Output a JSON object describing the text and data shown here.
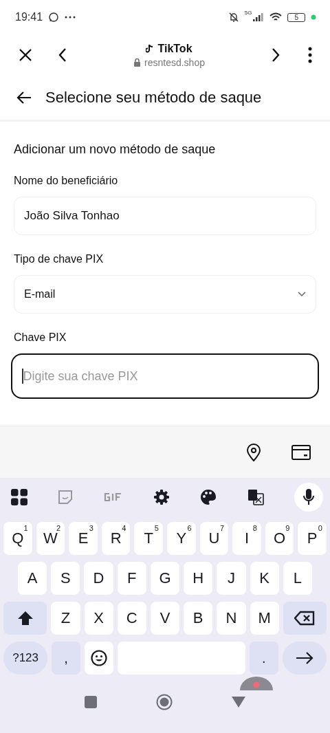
{
  "status_bar": {
    "time": "19:41",
    "network": "5G",
    "battery": "5"
  },
  "browser": {
    "title": "TikTok",
    "url": "resntesd.shop"
  },
  "page": {
    "title": "Selecione seu método de saque",
    "section": "Adicionar um novo método de saque"
  },
  "fields": [
    {
      "kind": "text",
      "label": "Nome do beneficiário",
      "value": "João Silva Tonhao",
      "focused": false
    },
    {
      "kind": "select",
      "label": "Tipo de chave PIX",
      "value": "E-mail",
      "focused": false
    },
    {
      "kind": "input",
      "label": "Chave PIX",
      "placeholder": "Digite sua chave PIX",
      "focused": true
    }
  ],
  "keyboard": {
    "rows": [
      [
        {
          "kind": "letter",
          "label": "Q",
          "hint": "1"
        },
        {
          "kind": "letter",
          "label": "W",
          "hint": "2"
        },
        {
          "kind": "letter",
          "label": "E",
          "hint": "3"
        },
        {
          "kind": "letter",
          "label": "R",
          "hint": "4"
        },
        {
          "kind": "letter",
          "label": "T",
          "hint": "5"
        },
        {
          "kind": "letter",
          "label": "Y",
          "hint": "6"
        },
        {
          "kind": "letter",
          "label": "U",
          "hint": "7"
        },
        {
          "kind": "letter",
          "label": "I",
          "hint": "8"
        },
        {
          "kind": "letter",
          "label": "O",
          "hint": "9"
        },
        {
          "kind": "letter",
          "label": "P",
          "hint": "0"
        }
      ],
      [
        {
          "kind": "letter",
          "label": "A"
        },
        {
          "kind": "letter",
          "label": "S"
        },
        {
          "kind": "letter",
          "label": "D"
        },
        {
          "kind": "letter",
          "label": "F"
        },
        {
          "kind": "letter",
          "label": "G"
        },
        {
          "kind": "letter",
          "label": "H"
        },
        {
          "kind": "letter",
          "label": "J"
        },
        {
          "kind": "letter",
          "label": "K"
        },
        {
          "kind": "letter",
          "label": "L"
        }
      ],
      [
        {
          "kind": "shift"
        },
        {
          "kind": "letter",
          "label": "Z"
        },
        {
          "kind": "letter",
          "label": "X"
        },
        {
          "kind": "letter",
          "label": "C"
        },
        {
          "kind": "letter",
          "label": "V"
        },
        {
          "kind": "letter",
          "label": "B"
        },
        {
          "kind": "letter",
          "label": "N"
        },
        {
          "kind": "letter",
          "label": "M"
        },
        {
          "kind": "backspace"
        }
      ]
    ],
    "bottom_row": [
      {
        "kind": "symbols",
        "label": "?123"
      },
      {
        "kind": "punct",
        "label": ","
      },
      {
        "kind": "emoji"
      },
      {
        "kind": "space"
      },
      {
        "kind": "punct",
        "label": "."
      },
      {
        "kind": "enter"
      }
    ]
  }
}
